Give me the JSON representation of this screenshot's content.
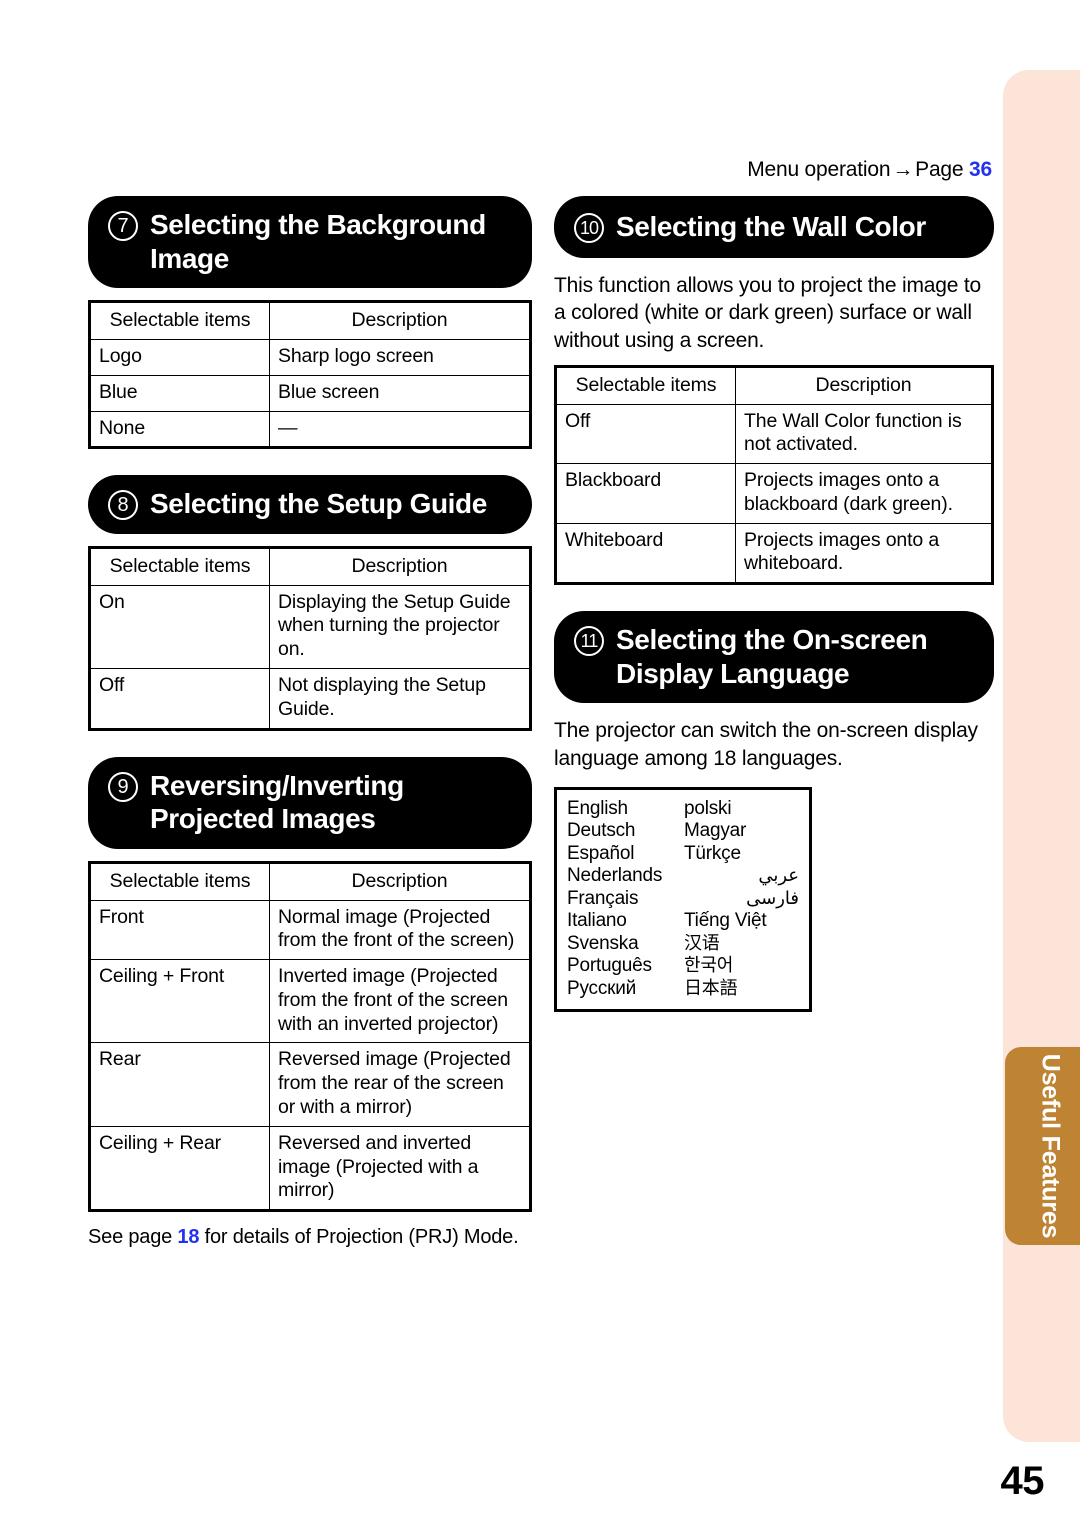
{
  "page": {
    "number": "45",
    "side_tab_label": "Useful Features",
    "side_tab_color": "#be8433",
    "side_panel_color": "#fce4d8",
    "link_color": "#2233ee"
  },
  "top_note": {
    "prefix": "Menu operation",
    "arrow": "→",
    "middle": "Page",
    "page_ref": "36"
  },
  "sections": {
    "background_image": {
      "number": "⑦",
      "number_plain": "7",
      "title": "Selecting the Background Image",
      "table": {
        "headers": [
          "Selectable items",
          "Description"
        ],
        "rows": [
          [
            "Logo",
            "Sharp logo screen"
          ],
          [
            "Blue",
            "Blue screen"
          ],
          [
            "None",
            "—"
          ]
        ]
      }
    },
    "setup_guide": {
      "number": "⑧",
      "number_plain": "8",
      "title": "Selecting the Setup Guide",
      "table": {
        "headers": [
          "Selectable items",
          "Description"
        ],
        "rows": [
          [
            "On",
            "Displaying the Setup Guide when turning the projector on."
          ],
          [
            "Off",
            "Not displaying the Setup Guide."
          ]
        ]
      }
    },
    "reversing_inverting": {
      "number": "⑨",
      "number_plain": "9",
      "title": "Reversing/Inverting Projected Images",
      "table": {
        "headers": [
          "Selectable items",
          "Description"
        ],
        "rows": [
          [
            "Front",
            "Normal image (Projected from the front of the screen)"
          ],
          [
            "Ceiling + Front",
            "Inverted image (Projected from the front of the screen with an inverted projector)"
          ],
          [
            "Rear",
            "Reversed image (Projected from the rear of the screen or with a mirror)"
          ],
          [
            "Ceiling + Rear",
            "Reversed and inverted image (Projected with a mirror)"
          ]
        ]
      },
      "note_prefix": "See page",
      "note_page_ref": "18",
      "note_suffix": "for details of Projection (PRJ) Mode."
    },
    "wall_color": {
      "number": "⑩",
      "number_plain": "10",
      "title": "Selecting the Wall Color",
      "intro": "This function allows you to project the image to a colored (white or dark green) surface or wall without using a screen.",
      "table": {
        "headers": [
          "Selectable items",
          "Description"
        ],
        "rows": [
          [
            "Off",
            "The Wall Color function is not activated."
          ],
          [
            "Blackboard",
            "Projects images onto a blackboard (dark green)."
          ],
          [
            "Whiteboard",
            "Projects images onto a whiteboard."
          ]
        ]
      }
    },
    "display_language": {
      "number": "⑪",
      "number_plain": "11",
      "title": "Selecting the On-screen Display Language",
      "intro": "The projector can switch the on-screen display language among 18 languages.",
      "languages_left": [
        "English",
        "Deutsch",
        "Español",
        "Nederlands",
        "Français",
        "Italiano",
        "Svenska",
        "Português",
        "Русский"
      ],
      "languages_right": [
        "polski",
        "Magyar",
        "Türkçe",
        "عربي",
        "فارسی",
        "Tiếng Việt",
        "汉语",
        "한국어",
        "日本語"
      ]
    }
  }
}
